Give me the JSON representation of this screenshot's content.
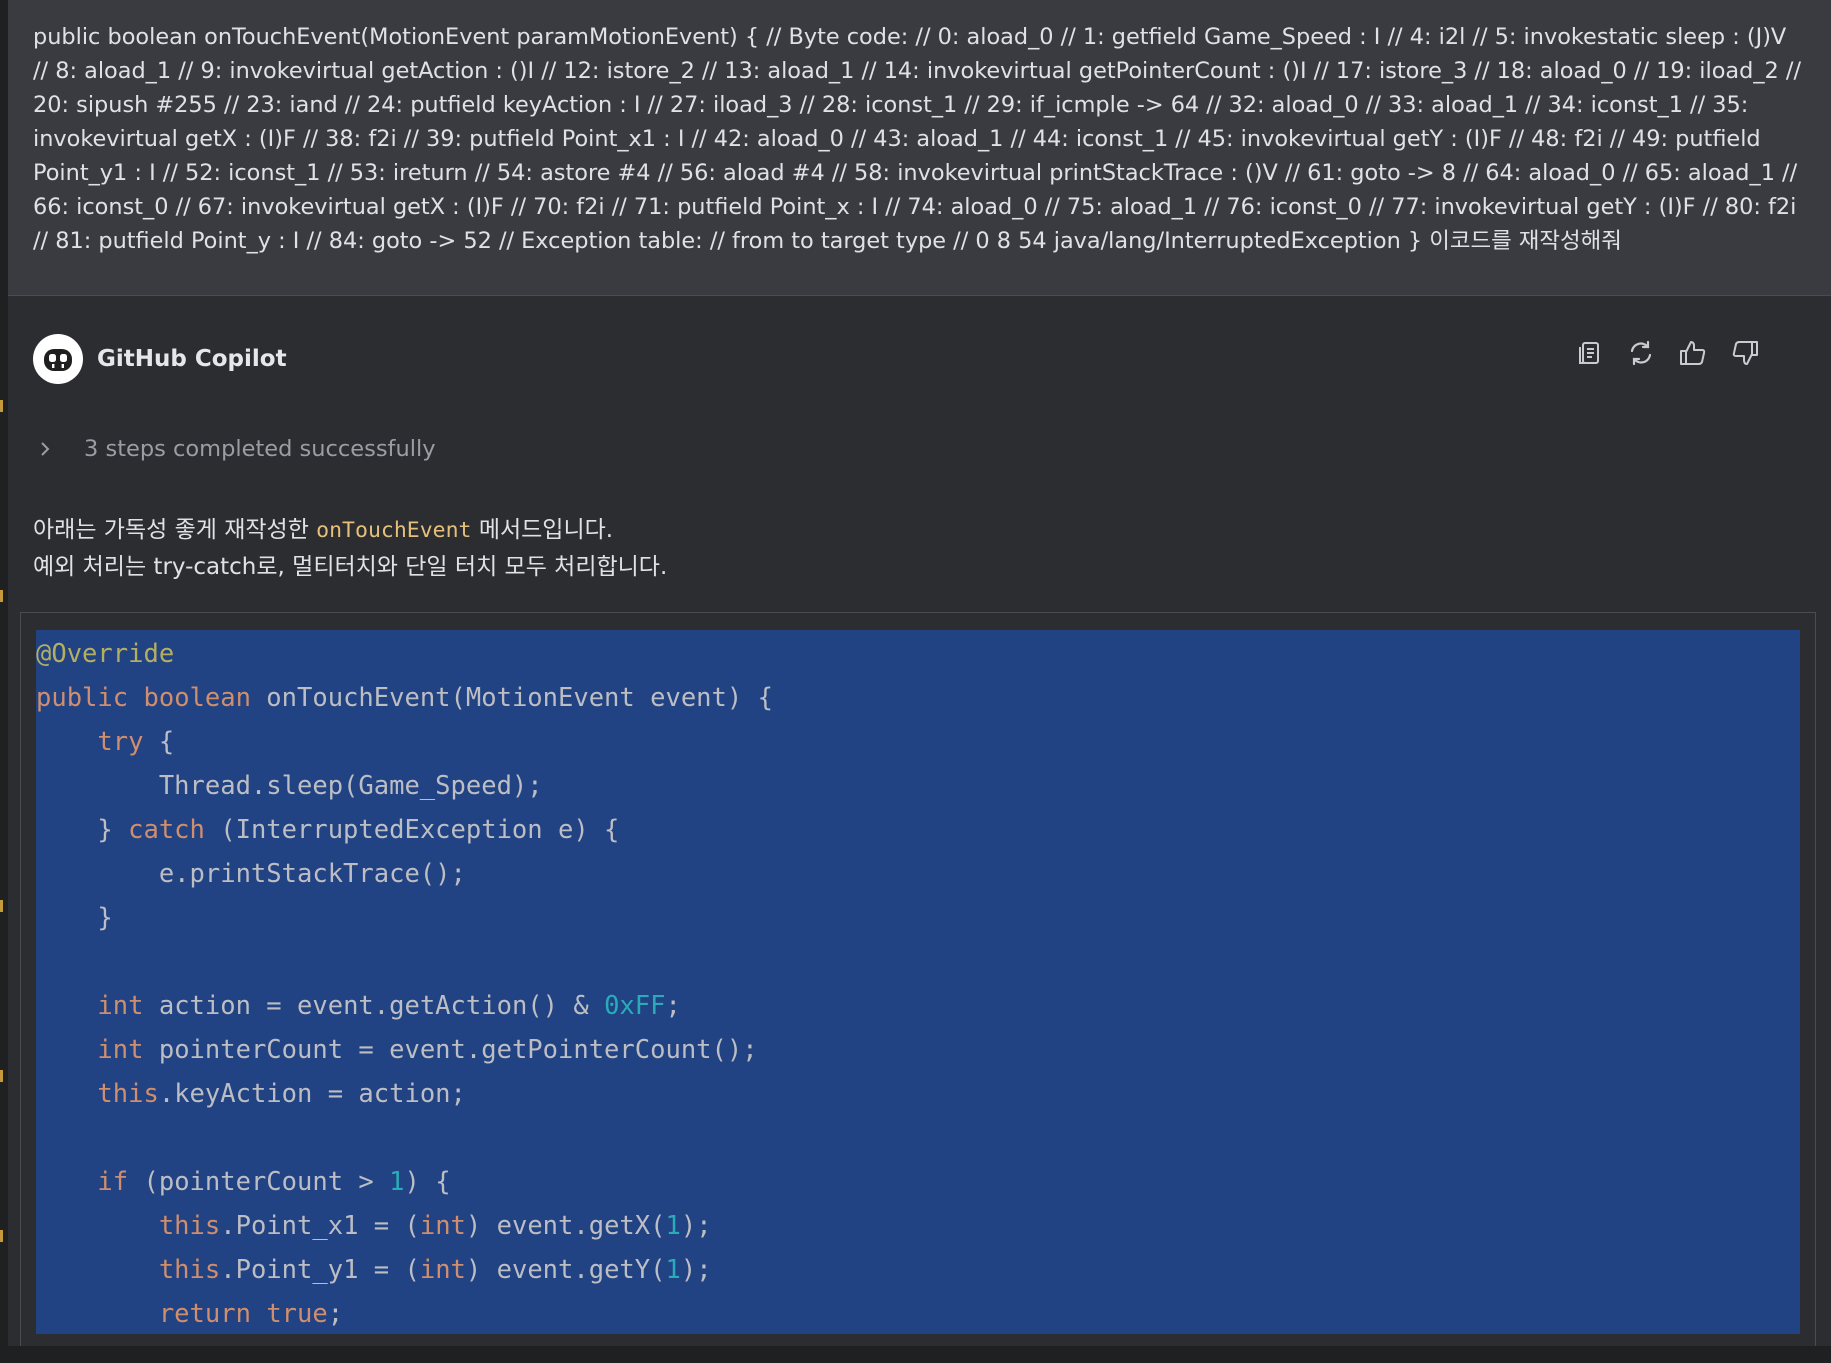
{
  "user_prompt": {
    "text": "public boolean onTouchEvent(MotionEvent paramMotionEvent) { // Byte code: // 0: aload_0 // 1: getfield Game_Speed : I // 4: i2l // 5: invokestatic sleep : (J)V // 8: aload_1 // 9: invokevirtual getAction : ()I // 12: istore_2 // 13: aload_1 // 14: invokevirtual getPointerCount : ()I // 17: istore_3 // 18: aload_0 // 19: iload_2 // 20: sipush #255 // 23: iand // 24: putfield keyAction : I // 27: iload_3 // 28: iconst_1 // 29: if_icmple -> 64 // 32: aload_0 // 33: aload_1 // 34: iconst_1 // 35: invokevirtual getX : (I)F // 38: f2i // 39: putfield Point_x1 : I // 42: aload_0 // 43: aload_1 // 44: iconst_1 // 45: invokevirtual getY : (I)F // 48: f2i // 49: putfield Point_y1 : I // 52: iconst_1 // 53: ireturn // 54: astore #4 // 56: aload #4 // 58: invokevirtual printStackTrace : ()V // 61: goto -> 8 // 64: aload_0 // 65: aload_1 // 66: iconst_0 // 67: invokevirtual getX : (I)F // 70: f2i // 71: putfield Point_x : I // 74: aload_0 // 75: aload_1 // 76: iconst_0 // 77: invokevirtual getY : (I)F // 80: f2i // 81: putfield Point_y : I // 84: goto -> 52 // Exception table: // from to target type // 0 8 54 java/lang/InterruptedException } 이코드를 재작성해줘"
  },
  "assistant": {
    "name": "GitHub Copilot",
    "avatar_icon": "copilot-icon",
    "actions": [
      {
        "name": "copy-button",
        "icon": "copy-icon"
      },
      {
        "name": "regenerate-button",
        "icon": "refresh-icon"
      },
      {
        "name": "thumbs-up-button",
        "icon": "thumbs-up-icon"
      },
      {
        "name": "thumbs-down-button",
        "icon": "thumbs-down-icon"
      }
    ],
    "steps_label": "3 steps completed successfully",
    "description": {
      "line1_before": "아래는 가독성 좋게 재작성한 ",
      "line1_code": "onTouchEvent",
      "line1_after": " 메서드입니다.",
      "line2": "예외 처리는 try-catch로, 멀티터치와 단일 터치 모두 처리합니다."
    },
    "code_block": {
      "selected": true,
      "lines": [
        [
          [
            "ann",
            "@Override"
          ]
        ],
        [
          [
            "kw",
            "public"
          ],
          [
            "plain",
            " "
          ],
          [
            "kw",
            "boolean"
          ],
          [
            "plain",
            " onTouchEvent(MotionEvent event) {"
          ]
        ],
        [
          [
            "plain",
            "    "
          ],
          [
            "kw",
            "try"
          ],
          [
            "plain",
            " {"
          ]
        ],
        [
          [
            "plain",
            "        Thread.sleep(Game_Speed);"
          ]
        ],
        [
          [
            "plain",
            "    } "
          ],
          [
            "kw",
            "catch"
          ],
          [
            "plain",
            " (InterruptedException e) {"
          ]
        ],
        [
          [
            "plain",
            "        e.printStackTrace();"
          ]
        ],
        [
          [
            "plain",
            "    }"
          ]
        ],
        [
          [
            "plain",
            ""
          ]
        ],
        [
          [
            "plain",
            "    "
          ],
          [
            "kw",
            "int"
          ],
          [
            "plain",
            " action = event.getAction() & "
          ],
          [
            "num",
            "0xFF"
          ],
          [
            "plain",
            ";"
          ]
        ],
        [
          [
            "plain",
            "    "
          ],
          [
            "kw",
            "int"
          ],
          [
            "plain",
            " pointerCount = event.getPointerCount();"
          ]
        ],
        [
          [
            "plain",
            "    "
          ],
          [
            "kw",
            "this"
          ],
          [
            "plain",
            ".keyAction = action;"
          ]
        ],
        [
          [
            "plain",
            ""
          ]
        ],
        [
          [
            "plain",
            "    "
          ],
          [
            "kw",
            "if"
          ],
          [
            "plain",
            " (pointerCount > "
          ],
          [
            "num",
            "1"
          ],
          [
            "plain",
            ") {"
          ]
        ],
        [
          [
            "plain",
            "        "
          ],
          [
            "kw",
            "this"
          ],
          [
            "plain",
            ".Point_x1 = ("
          ],
          [
            "kw",
            "int"
          ],
          [
            "plain",
            ") event.getX("
          ],
          [
            "num",
            "1"
          ],
          [
            "plain",
            ");"
          ]
        ],
        [
          [
            "plain",
            "        "
          ],
          [
            "kw",
            "this"
          ],
          [
            "plain",
            ".Point_y1 = ("
          ],
          [
            "kw",
            "int"
          ],
          [
            "plain",
            ") event.getY("
          ],
          [
            "num",
            "1"
          ],
          [
            "plain",
            ");"
          ]
        ],
        [
          [
            "plain",
            "        "
          ],
          [
            "kw",
            "return"
          ],
          [
            "plain",
            " "
          ],
          [
            "kw",
            "true"
          ],
          [
            "plain",
            ";"
          ]
        ]
      ]
    }
  },
  "colors": {
    "background": "#2b2d30",
    "prompt_background": "#393b40",
    "selection": "#214283",
    "keyword": "#cf8e6d",
    "number": "#2aacb8",
    "annotation": "#b3ae60",
    "inline_code": "#e5c07b"
  }
}
